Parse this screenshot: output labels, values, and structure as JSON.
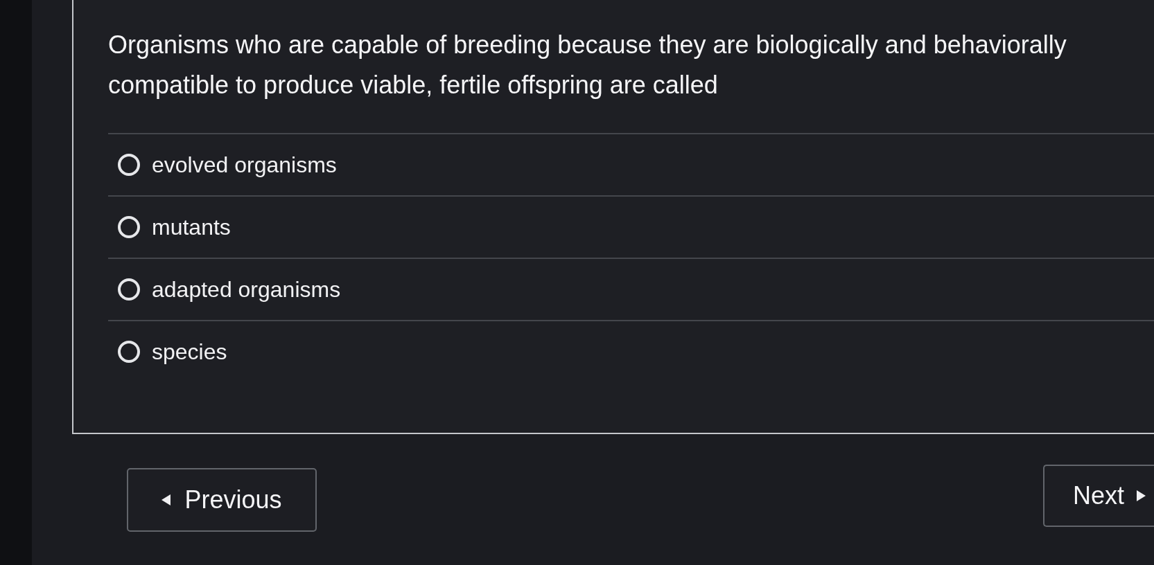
{
  "question": "Organisms who are capable of breeding because they are biologically and behaviorally compatible to produce viable, fertile offspring are called",
  "options": [
    {
      "label": "evolved organisms",
      "selected": false
    },
    {
      "label": "mutants",
      "selected": false
    },
    {
      "label": "adapted organisms",
      "selected": false
    },
    {
      "label": "species",
      "selected": false
    }
  ],
  "navigation": {
    "previous": "Previous",
    "next": "Next"
  }
}
